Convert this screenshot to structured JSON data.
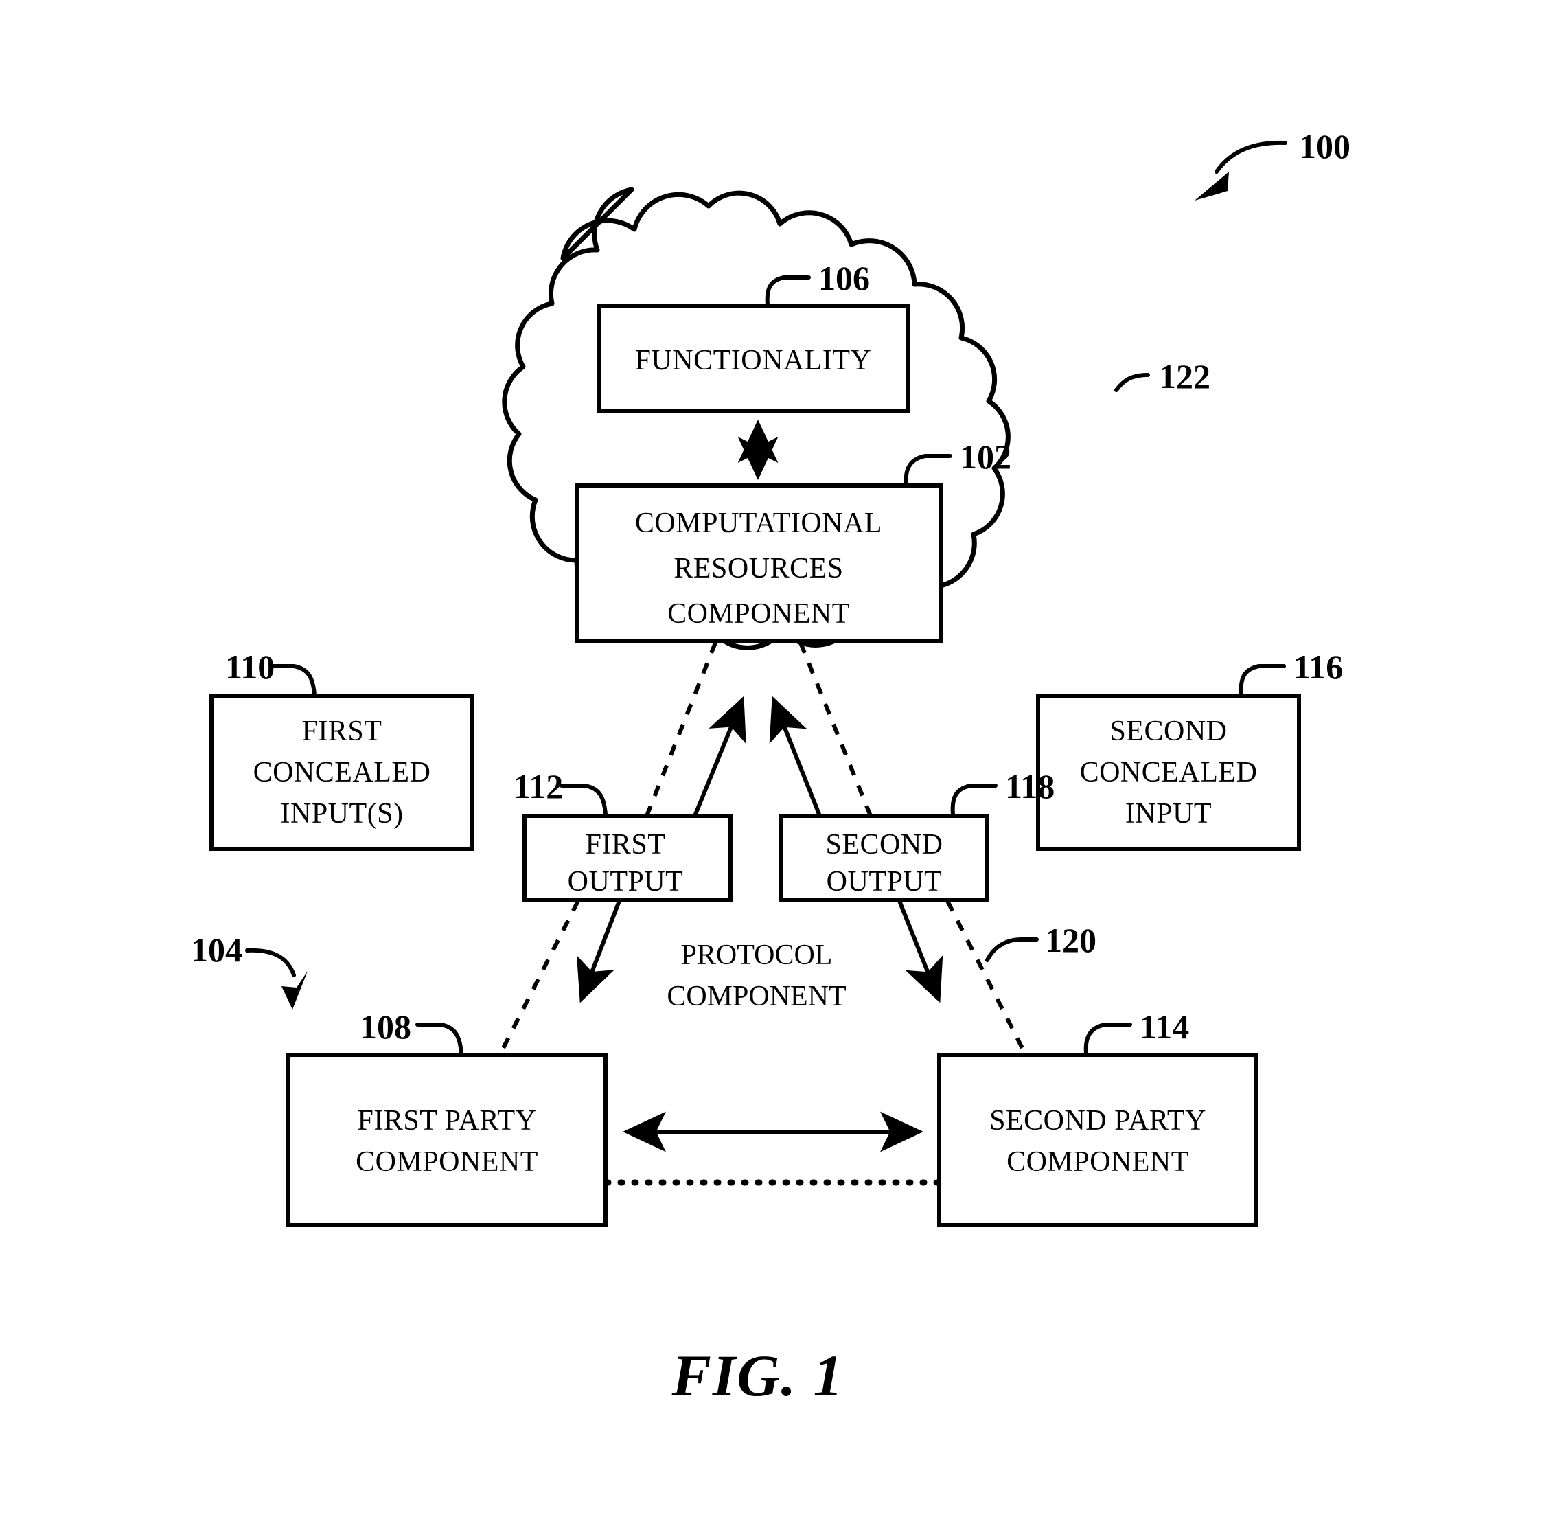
{
  "figure": {
    "caption": "FIG. 1",
    "system_ref": "100"
  },
  "cloud": {
    "ref": "122"
  },
  "boxes": {
    "functionality": {
      "ref": "106",
      "lines": [
        "FUNCTIONALITY"
      ]
    },
    "computational_resources": {
      "ref": "102",
      "lines": [
        "COMPUTATIONAL",
        "RESOURCES",
        "COMPONENT"
      ]
    },
    "first_concealed_input": {
      "ref": "110",
      "lines": [
        "FIRST",
        "CONCEALED",
        "INPUT(S)"
      ]
    },
    "second_concealed_input": {
      "ref": "116",
      "lines": [
        "SECOND",
        "CONCEALED",
        "INPUT"
      ]
    },
    "first_output": {
      "ref": "112",
      "lines": [
        "FIRST",
        "OUTPUT"
      ]
    },
    "second_output": {
      "ref": "118",
      "lines": [
        "SECOND",
        "OUTPUT"
      ]
    },
    "first_party": {
      "ref": "108",
      "lines": [
        "FIRST PARTY",
        "COMPONENT"
      ]
    },
    "second_party": {
      "ref": "114",
      "lines": [
        "SECOND PARTY",
        "COMPONENT"
      ]
    }
  },
  "free_labels": {
    "protocol_component": {
      "ref": "104",
      "lines": [
        "PROTOCOL",
        "COMPONENT"
      ]
    },
    "second_protocol_ref": "120"
  },
  "colors": {
    "ink": "#000000",
    "paper": "#ffffff"
  }
}
